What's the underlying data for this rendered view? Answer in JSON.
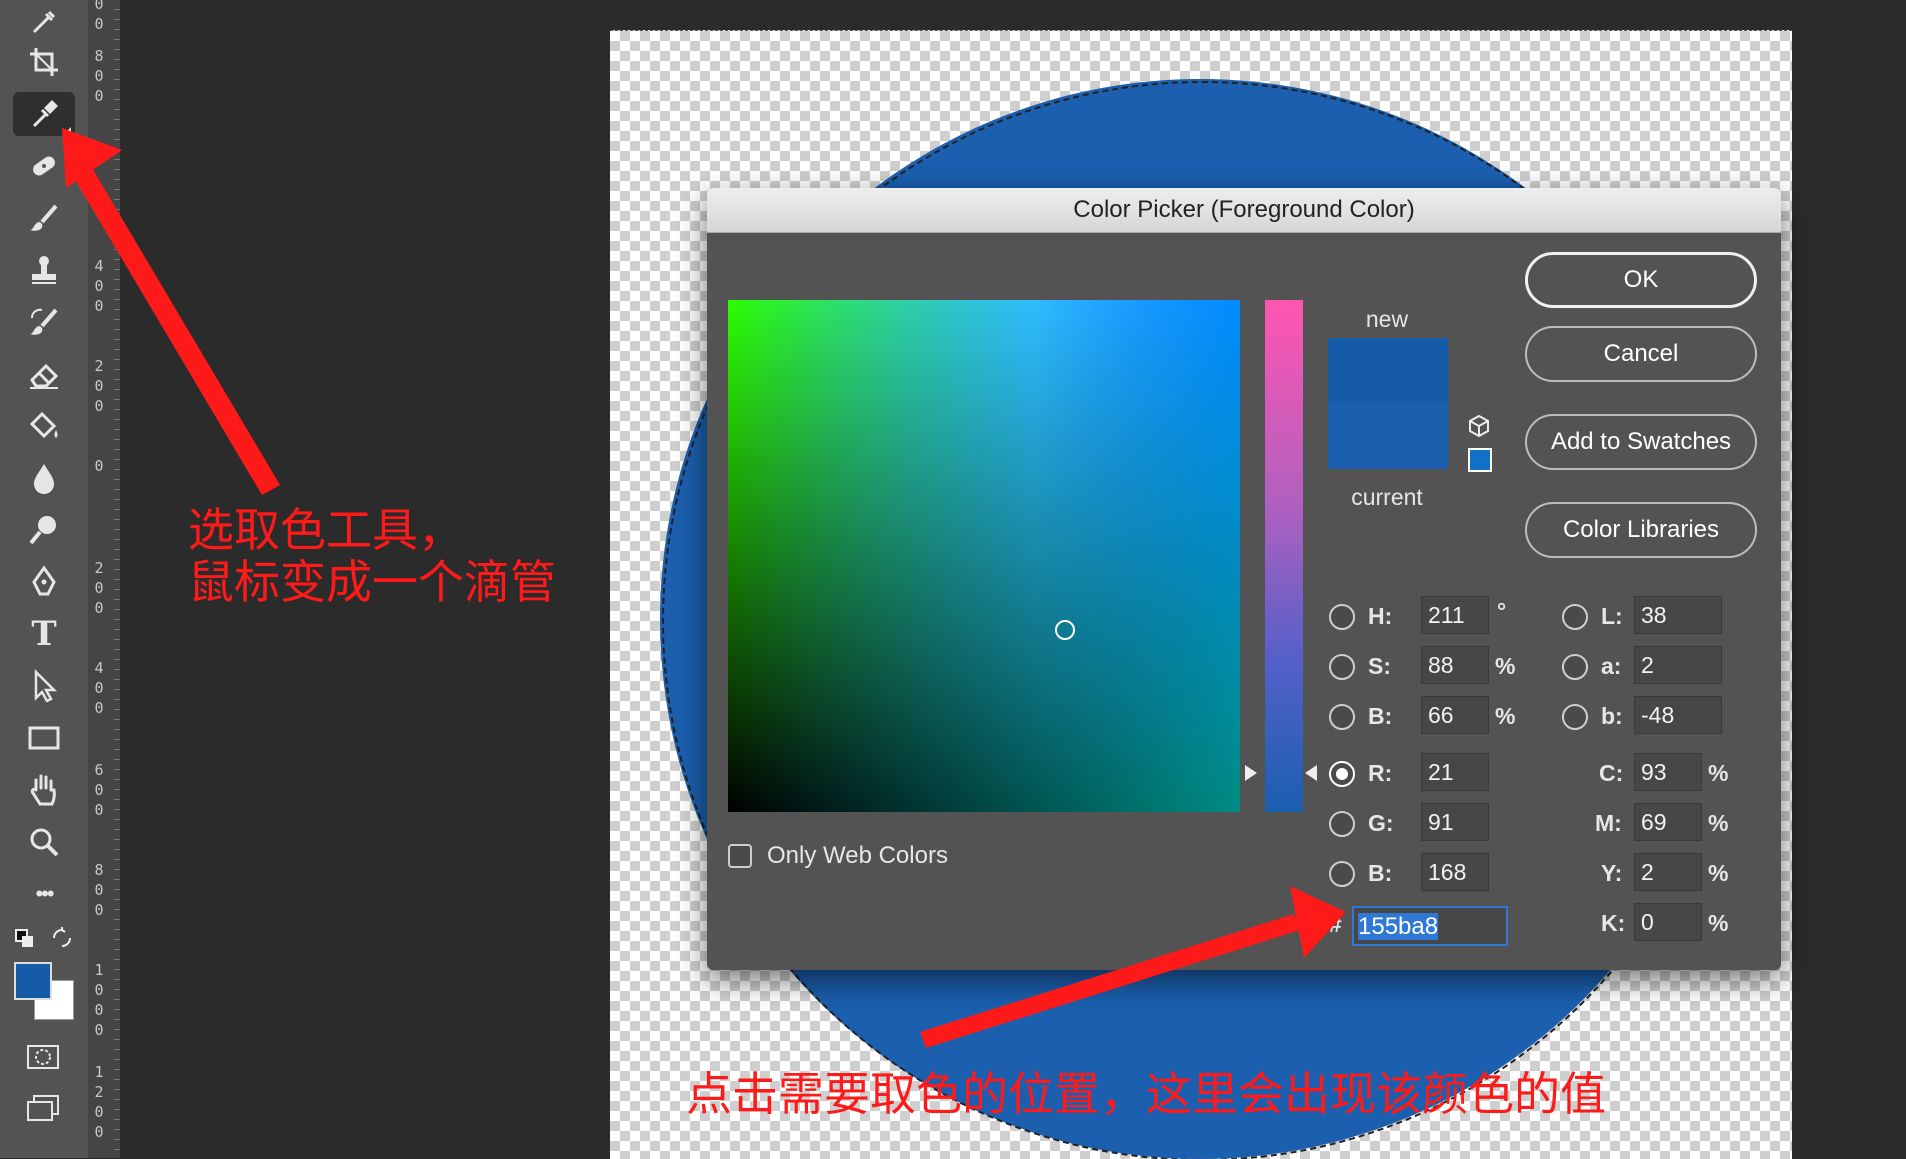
{
  "toolbar": {
    "tools": [
      {
        "name": "eyedropper-sample-icon"
      },
      {
        "name": "crop-icon"
      },
      {
        "name": "eyedropper-icon",
        "active": true
      },
      {
        "name": "healing-brush-icon"
      },
      {
        "name": "brush-icon"
      },
      {
        "name": "clone-stamp-icon"
      },
      {
        "name": "history-brush-icon"
      },
      {
        "name": "eraser-icon"
      },
      {
        "name": "paint-bucket-icon"
      },
      {
        "name": "blur-drop-icon"
      },
      {
        "name": "dodge-icon"
      },
      {
        "name": "pen-icon"
      },
      {
        "name": "type-icon",
        "glyph": "T"
      },
      {
        "name": "path-selection-icon"
      },
      {
        "name": "rectangle-icon"
      },
      {
        "name": "hand-icon"
      },
      {
        "name": "zoom-icon"
      },
      {
        "name": "more-tools-icon",
        "glyph": "•••"
      }
    ],
    "foreground_color": "#155ba8",
    "background_color": "#ffffff"
  },
  "ruler": {
    "labels": [
      "00",
      "800",
      "400",
      "200",
      "0",
      "200",
      "400",
      "600",
      "800",
      "1000",
      "1200"
    ]
  },
  "dialog": {
    "title": "Color Picker (Foreground Color)",
    "new_label": "new",
    "current_label": "current",
    "new_color": "#155ba8",
    "current_color": "#1b5fae",
    "buttons": {
      "ok": "OK",
      "cancel": "Cancel",
      "add_to_swatches": "Add to Swatches",
      "color_libraries": "Color Libraries"
    },
    "only_web_colors": "Only Web Colors",
    "fields": {
      "H": {
        "label": "H:",
        "value": "211",
        "unit": "°"
      },
      "S": {
        "label": "S:",
        "value": "88",
        "unit": "%"
      },
      "Bv": {
        "label": "B:",
        "value": "66",
        "unit": "%"
      },
      "R": {
        "label": "R:",
        "value": "21"
      },
      "G": {
        "label": "G:",
        "value": "91"
      },
      "Bl": {
        "label": "B:",
        "value": "168"
      },
      "L": {
        "label": "L:",
        "value": "38"
      },
      "a": {
        "label": "a:",
        "value": "2"
      },
      "b": {
        "label": "b:",
        "value": "-48"
      },
      "C": {
        "label": "C:",
        "value": "93",
        "unit": "%"
      },
      "M": {
        "label": "M:",
        "value": "69",
        "unit": "%"
      },
      "Y": {
        "label": "Y:",
        "value": "2",
        "unit": "%"
      },
      "K": {
        "label": "K:",
        "value": "0",
        "unit": "%"
      }
    },
    "hash": "#",
    "hex": "155ba8",
    "selected_channel": "R"
  },
  "annotations": {
    "tool_note_line1": "选取色工具，",
    "tool_note_line2": "鼠标变成一个滴管",
    "hex_note": "点击需要取色的位置，这里会出现该颜色的值",
    "color": "#ff1a1a"
  }
}
